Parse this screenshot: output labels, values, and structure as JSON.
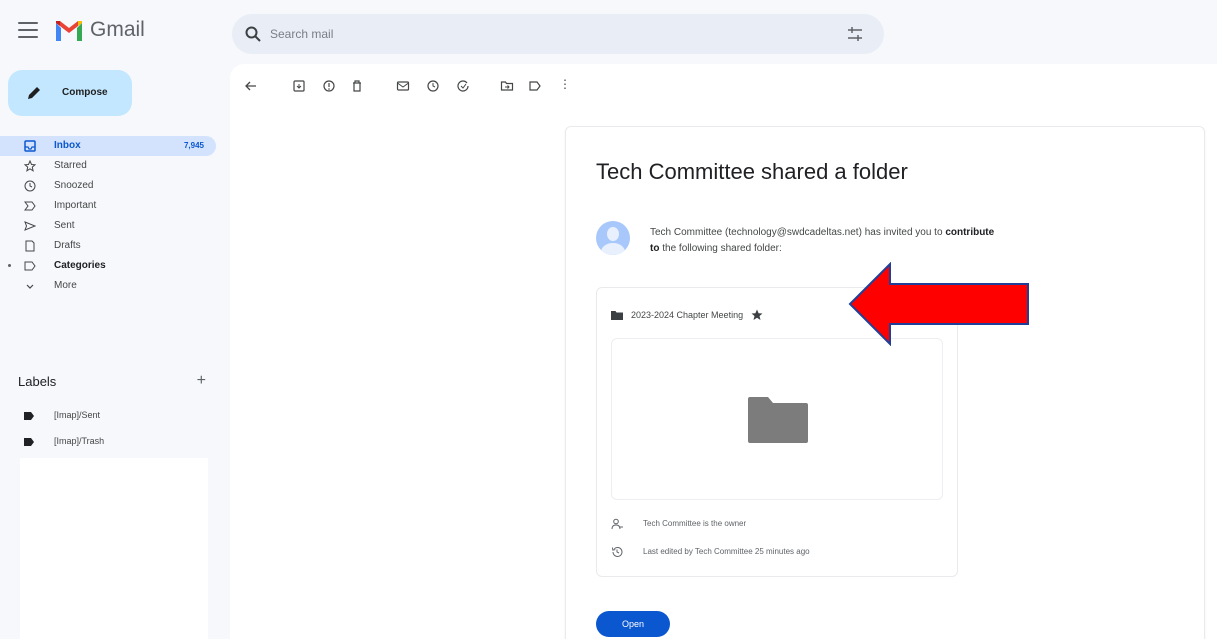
{
  "app": {
    "logo_text": "Gmail"
  },
  "search": {
    "placeholder": "Search mail"
  },
  "compose": {
    "label": "Compose"
  },
  "sidebar": {
    "items": [
      {
        "label": "Inbox",
        "count": "7,945",
        "icon": "inbox-icon"
      },
      {
        "label": "Starred",
        "icon": "star-icon"
      },
      {
        "label": "Snoozed",
        "icon": "clock-icon"
      },
      {
        "label": "Important",
        "icon": "important-icon"
      },
      {
        "label": "Sent",
        "icon": "send-icon"
      },
      {
        "label": "Drafts",
        "icon": "draft-icon"
      },
      {
        "label": "Categories",
        "icon": "label-icon"
      },
      {
        "label": "More",
        "icon": "chevron-down-icon"
      }
    ]
  },
  "labels": {
    "title": "Labels",
    "add": "+",
    "items": [
      {
        "label": "[Imap]/Sent"
      },
      {
        "label": "[Imap]/Trash"
      }
    ]
  },
  "toolbar": {
    "icons": [
      "back-arrow-icon",
      "archive-icon",
      "report-spam-icon",
      "delete-icon",
      "mark-unread-icon",
      "snooze-icon",
      "add-task-icon",
      "move-to-icon",
      "label-icon",
      "more-vert-icon"
    ],
    "more": "⋮"
  },
  "email": {
    "subject": "Tech Committee shared a folder",
    "invite_prefix": "Tech Committee (technology@swdcadeltas.net) has invited you to ",
    "invite_bold1": "contribute",
    "invite_bold2": "to",
    "invite_suffix": " the following shared folder:",
    "folder_name": "2023-2024 Chapter Meeting",
    "owner_text": "Tech Committee is the owner",
    "edited_text": "Last edited by Tech Committee 25 minutes ago",
    "open_label": "Open"
  },
  "colors": {
    "annotation_arrow": "#ff0000",
    "arrow_outline": "#1f3f99",
    "primary": "#0b57d0",
    "compose_bg": "#c2e7ff"
  }
}
